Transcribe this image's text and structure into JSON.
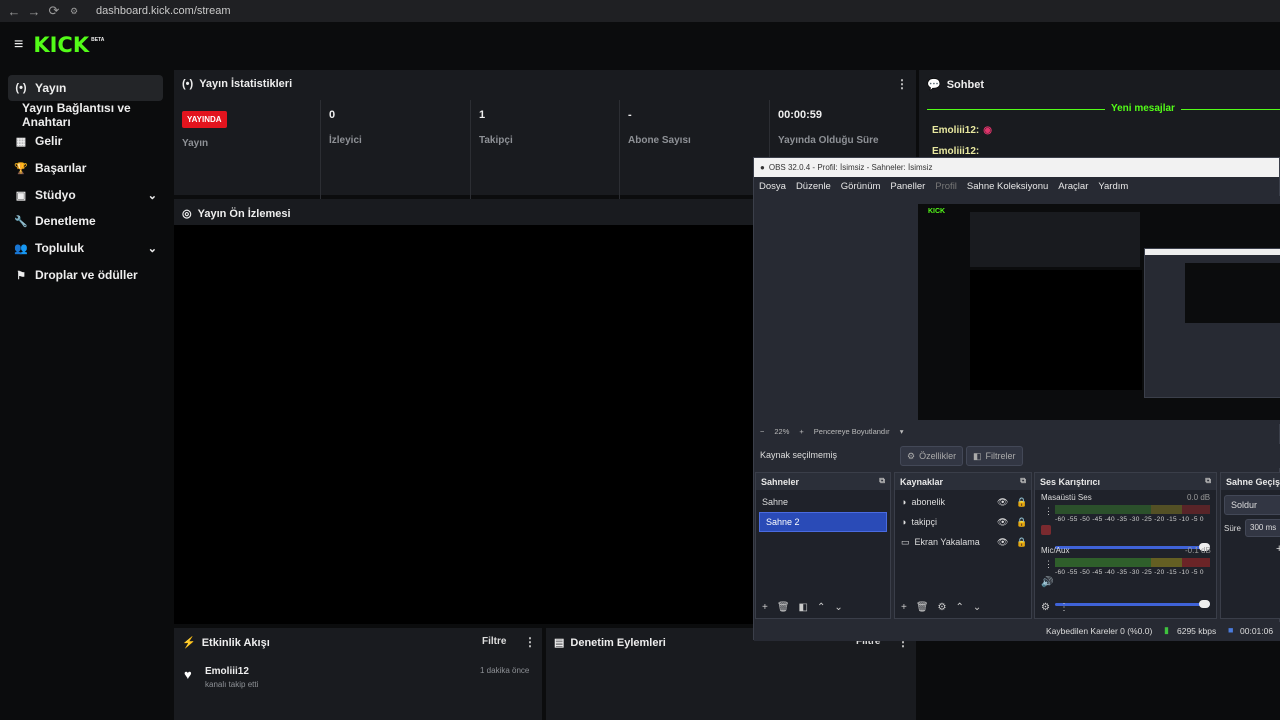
{
  "browser": {
    "url": "dashboard.kick.com/stream",
    "back": "←",
    "forward": "→",
    "reload": "⟳"
  },
  "header": {
    "logo": "KICK",
    "beta": "BETA",
    "menu_icon": "≡"
  },
  "sidebar": {
    "items": [
      {
        "label": "Yayın",
        "icon": "(•)"
      },
      {
        "label": "Yayın Bağlantısı ve Anahtarı",
        "icon": ""
      },
      {
        "label": "Gelir",
        "icon": "▦"
      },
      {
        "label": "Başarılar",
        "icon": "🏆"
      },
      {
        "label": "Stüdyo",
        "icon": "▣"
      },
      {
        "label": "Denetleme",
        "icon": "🔧"
      },
      {
        "label": "Topluluk",
        "icon": "👥"
      },
      {
        "label": "Droplar ve ödüller",
        "icon": "⚑"
      }
    ]
  },
  "stats": {
    "title": "Yayın İstatistikleri",
    "live_badge": "YAYINDA",
    "live_label": "Yayın",
    "viewers_value": "0",
    "viewers_label": "İzleyici",
    "followers_value": "1",
    "followers_label": "Takipçi",
    "subs_value": "-",
    "subs_label": "Abone Sayısı",
    "duration_value": "00:00:59",
    "duration_label": "Yayında Olduğu Süre"
  },
  "preview": {
    "title": "Yayın Ön İzlemesi"
  },
  "chat": {
    "title": "Sohbet",
    "divider": "Yeni mesajlar",
    "messages": [
      {
        "user": "Emoliii12:"
      },
      {
        "user": "Emoliii12:"
      }
    ]
  },
  "activity": {
    "title": "Etkinlik Akışı",
    "filter": "Filtre",
    "user": "Emoliii12",
    "time": "1 dakika önce",
    "text": "kanalı takip etti"
  },
  "moderation": {
    "title": "Denetim Eylemleri",
    "filter": "Filtre"
  },
  "obs": {
    "title": "OBS 32.0.4 - Profil: İsimsiz - Sahneler: İsimsiz",
    "menu": [
      "Dosya",
      "Düzenle",
      "Görünüm",
      "Paneller",
      "Profil",
      "Sahne Koleksiyonu",
      "Araçlar",
      "Yardım"
    ],
    "zoom": "22%",
    "fit": "Pencereye Boyutlandır",
    "no_source": "Kaynak seçilmemiş",
    "properties": "Özellikler",
    "filters": "Filtreler",
    "scenes_title": "Sahneler",
    "scenes": [
      "Sahne",
      "Sahne 2"
    ],
    "sources_title": "Kaynaklar",
    "sources": [
      "abonelik",
      "takipçi",
      "Ekran Yakalama"
    ],
    "mixer_title": "Ses Karıştırıcı",
    "desktop_label": "Masaüstü Ses",
    "desktop_db": "0.0 dB",
    "mic_label": "Mic/Aux",
    "mic_db": "-0.1 dB",
    "meter_ticks": "-60 -55 -50 -45 -40 -35 -30 -25 -20 -15 -10 -5 0",
    "transitions_title": "Sahne Geçişl",
    "transition": "Soldur",
    "duration_label": "Süre",
    "duration_value": "300 ms",
    "status_dropped": "Kaybedilen Kareler 0 (%0.0)",
    "status_kbps": "6295 kbps",
    "status_time": "00:01:06"
  },
  "colors": {
    "accent": "#53fc18",
    "live": "#e3141e",
    "obs_select": "#2a4bb7"
  }
}
